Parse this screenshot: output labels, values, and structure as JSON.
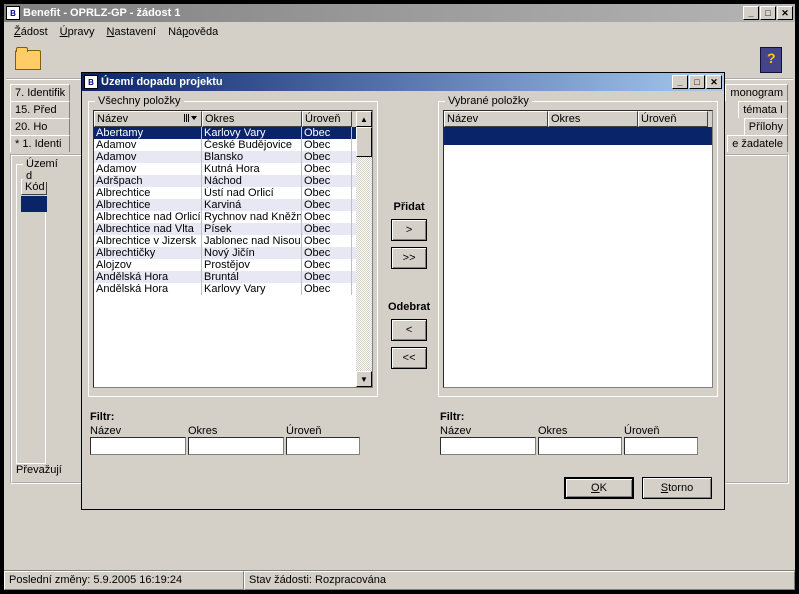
{
  "main_window": {
    "title": "Benefit - OPRLZ-GP - žádost 1",
    "menu": [
      "Žádost",
      "Úpravy",
      "Nastavení",
      "Nápověda"
    ],
    "tabs_left": [
      "7. Identifik",
      "15. Před",
      "20. Ho",
      "* 1. Identi"
    ],
    "tabs_right": [
      "monogram",
      "témata I",
      "Přílohy",
      "e žadatele"
    ],
    "inner_legend": "Území d",
    "inner_col": "Kód",
    "bottom_label": "Převažují",
    "status_left": "Poslední změny: 5.9.2005 16:19:24",
    "status_right": "Stav žádosti: Rozpracována"
  },
  "dialog": {
    "title": "Území dopadu projektu",
    "all_items": "Všechny položky",
    "selected_items": "Vybrané položky",
    "cols": {
      "name": "Název",
      "district": "Okres",
      "level": "Úroveň"
    },
    "rows": [
      {
        "n": "Abertamy",
        "o": "Karlovy Vary",
        "l": "Obec"
      },
      {
        "n": "Adamov",
        "o": "České Budějovice",
        "l": "Obec"
      },
      {
        "n": "Adamov",
        "o": "Blansko",
        "l": "Obec"
      },
      {
        "n": "Adamov",
        "o": "Kutná Hora",
        "l": "Obec"
      },
      {
        "n": "Adršpach",
        "o": "Náchod",
        "l": "Obec"
      },
      {
        "n": "Albrechtice",
        "o": "Ústí nad Orlicí",
        "l": "Obec"
      },
      {
        "n": "Albrechtice",
        "o": "Karviná",
        "l": "Obec"
      },
      {
        "n": "Albrechtice nad Orlicí",
        "o": "Rychnov nad Kněžn",
        "l": "Obec"
      },
      {
        "n": "Albrechtice nad Vlta",
        "o": "Písek",
        "l": "Obec"
      },
      {
        "n": "Albrechtice v Jizersk",
        "o": "Jablonec nad Nisou",
        "l": "Obec"
      },
      {
        "n": "Albrechtičky",
        "o": "Nový Jičín",
        "l": "Obec"
      },
      {
        "n": "Alojzov",
        "o": "Prostějov",
        "l": "Obec"
      },
      {
        "n": "Andělská Hora",
        "o": "Bruntál",
        "l": "Obec"
      },
      {
        "n": "Andělská Hora",
        "o": "Karlovy Vary",
        "l": "Obec"
      }
    ],
    "add": "Přidat",
    "remove": "Odebrat",
    "filter": "Filtr:",
    "ok": "OK",
    "cancel": "Storno",
    "arr_r": ">",
    "arr_rr": ">>",
    "arr_l": "<",
    "arr_ll": "<<"
  }
}
